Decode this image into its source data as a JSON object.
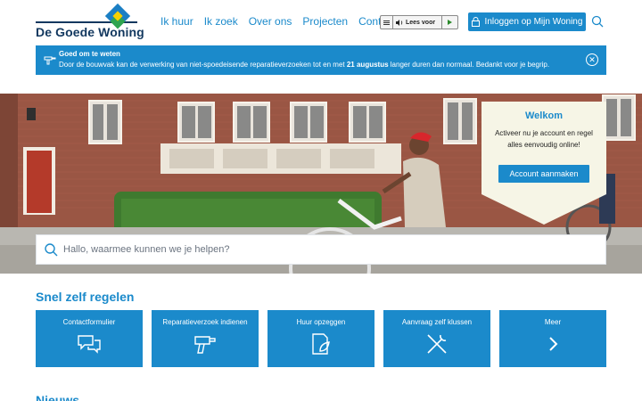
{
  "brand": {
    "name": "De Goede Woning",
    "primary": "#1b8acb",
    "dark": "#12385f"
  },
  "nav": {
    "items": [
      "Ik huur",
      "Ik zoek",
      "Over ons",
      "Projecten",
      "Contact"
    ]
  },
  "readspeaker": {
    "label": "Lees voor",
    "icon": "speaker-icon"
  },
  "login": {
    "label": "Inloggen op Mijn Woning",
    "icon": "lock-icon"
  },
  "notice": {
    "title": "Goed om te weten",
    "body_before": "Door de bouwvak kan de verwerking van niet-spoedeisende reparatieverzoeken tot en met ",
    "body_bold": "21 augustus",
    "body_after": " langer duren dan normaal. Bedankt voor je begrip."
  },
  "welcome": {
    "title": "Welkom",
    "text": "Activeer nu je account en regel alles eenvoudig online!",
    "button": "Account aanmaken"
  },
  "search": {
    "placeholder": "Hallo, waarmee kunnen we je helpen?"
  },
  "quick": {
    "title": "Snel zelf regelen",
    "tiles": [
      {
        "label": "Contactformulier",
        "icon": "chat-bubbles-icon"
      },
      {
        "label": "Reparatieverzoek indienen",
        "icon": "drill-icon"
      },
      {
        "label": "Huur opzeggen",
        "icon": "document-leaf-icon"
      },
      {
        "label": "Aanvraag zelf klussen",
        "icon": "tools-icon"
      },
      {
        "label": "Meer",
        "icon": "chevron-right-icon"
      }
    ]
  },
  "news": {
    "title": "Nieuws"
  }
}
